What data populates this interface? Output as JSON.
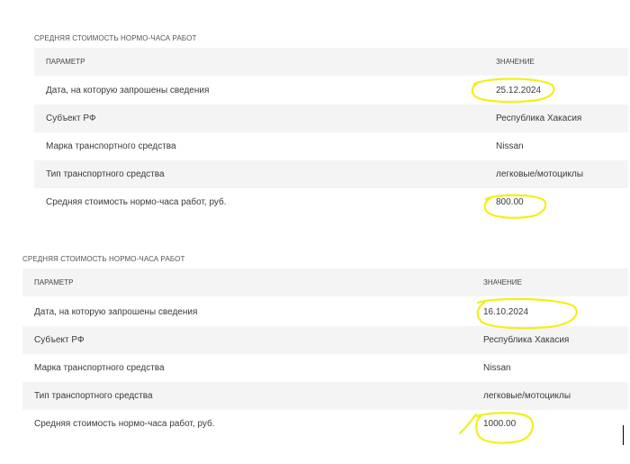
{
  "tables": [
    {
      "title": "СРЕДНЯЯ СТОИМОСТЬ НОРМО-ЧАСА РАБОТ",
      "header": {
        "param": "ПАРАМЕТР",
        "value": "ЗНАЧЕНИЕ"
      },
      "rows": [
        {
          "param": "Дата, на которую запрошены сведения",
          "value": "25.12.2024"
        },
        {
          "param": "Субъект РФ",
          "value": "Республика Хакасия"
        },
        {
          "param": "Марка транспортного средства",
          "value": "Nissan"
        },
        {
          "param": "Тип транспортного средства",
          "value": "легковые/мотоциклы"
        },
        {
          "param": "Средняя стоимость нормо-часа работ, руб.",
          "value": "800.00"
        }
      ]
    },
    {
      "title": "СРЕДНЯЯ СТОИМОСТЬ НОРМО-ЧАСА РАБОТ",
      "header": {
        "param": "ПАРАМЕТР",
        "value": "ЗНАЧЕНИЕ"
      },
      "rows": [
        {
          "param": "Дата, на которую запрошены сведения",
          "value": "16.10.2024"
        },
        {
          "param": "Субъект РФ",
          "value": "Республика Хакасия"
        },
        {
          "param": "Марка транспортного средства",
          "value": "Nissan"
        },
        {
          "param": "Тип транспортного средства",
          "value": "легковые/мотоциклы"
        },
        {
          "param": "Средняя стоимость нормо-часа работ, руб.",
          "value": "1000.00"
        }
      ]
    }
  ],
  "highlight_color": "#f3ef1a"
}
